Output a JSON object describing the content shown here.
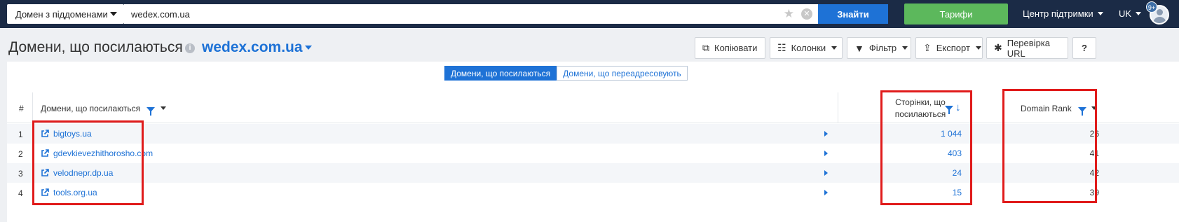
{
  "topbar": {
    "scope_select": "Домен з піддоменами",
    "search_value": "wedex.com.ua",
    "find_button": "Знайти",
    "tariffs_button": "Тарифи",
    "support_menu": "Центр підтримки",
    "language": "UK",
    "notification_badge": "9+"
  },
  "header": {
    "title": "Домени, що посилаються",
    "domain": "wedex.com.ua",
    "buttons": {
      "copy": "Копіювати",
      "columns": "Колонки",
      "filter": "Фільтр",
      "export": "Експорт",
      "check_url": "Перевірка URL",
      "help": "?"
    }
  },
  "tabs": [
    {
      "label": "Домени, що посилаються",
      "active": true
    },
    {
      "label": "Домени, що переадресовують",
      "active": false
    }
  ],
  "table": {
    "columns": {
      "num": "#",
      "domain": "Домени, що посилаються",
      "pages_line1": "Сторінки, що",
      "pages_line2": "посилаються",
      "rank": "Domain Rank"
    },
    "rows": [
      {
        "num": "1",
        "domain": "bigtoys.ua",
        "pages": "1 044",
        "rank": "26"
      },
      {
        "num": "2",
        "domain": "gdevkievezhithorosho.com",
        "pages": "403",
        "rank": "41"
      },
      {
        "num": "3",
        "domain": "velodnepr.dp.ua",
        "pages": "24",
        "rank": "42"
      },
      {
        "num": "4",
        "domain": "tools.org.ua",
        "pages": "15",
        "rank": "39"
      }
    ]
  },
  "colors": {
    "topbar": "#1b2b46",
    "accent_blue": "#1e72d6",
    "tariff_green": "#5cb85c",
    "highlight_red": "#e01b1b"
  }
}
